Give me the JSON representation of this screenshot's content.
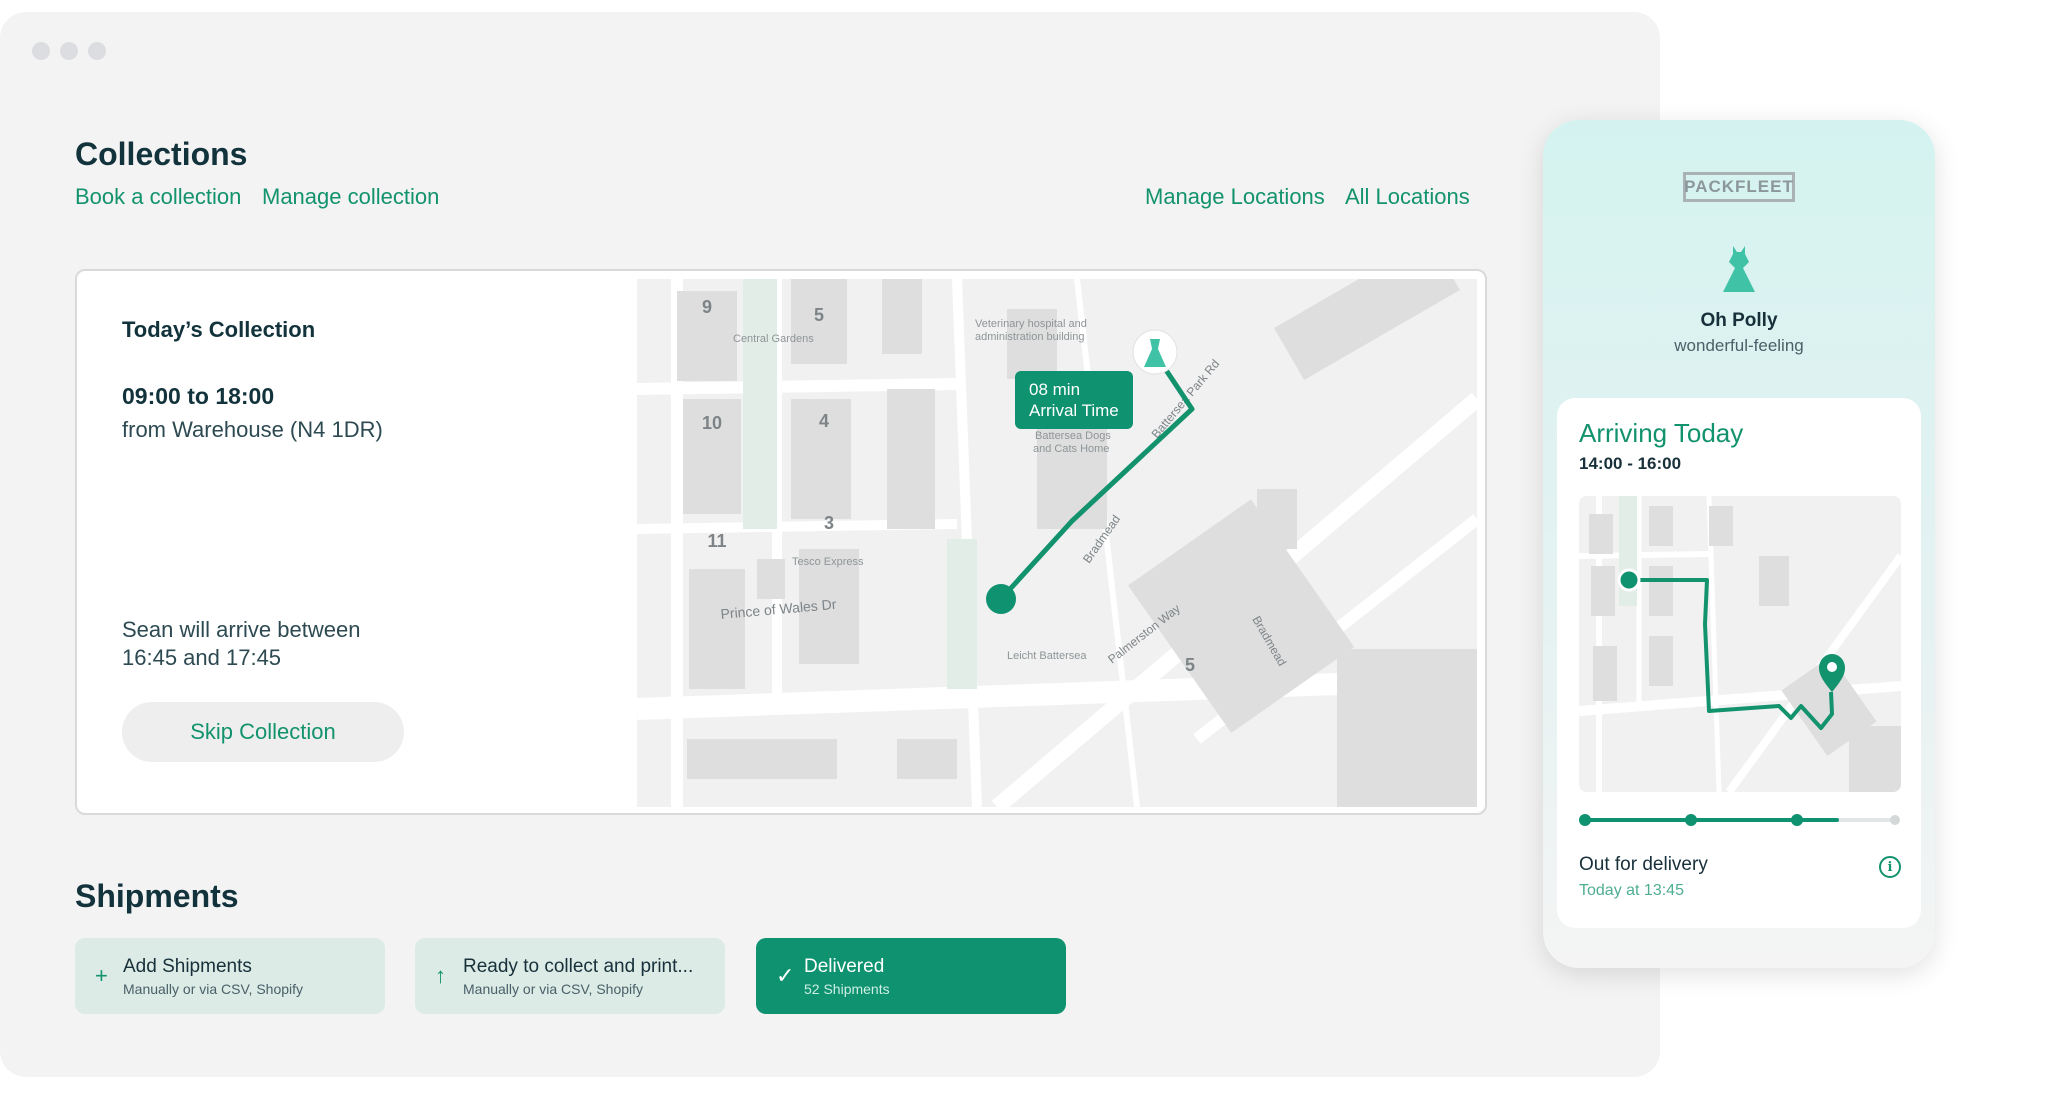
{
  "collections": {
    "title": "Collections",
    "links": {
      "book": "Book a collection",
      "manage": "Manage collection",
      "manage_locations": "Manage Locations",
      "all_locations": "All Locations"
    }
  },
  "todays_collection": {
    "title": "Today’s Collection",
    "time": "09:00 to 18:00",
    "from": "from Warehouse (N4 1DR)",
    "arrival_line1": "Sean will arrive between",
    "arrival_line2": "16:45 and 17:45",
    "skip_label": "Skip Collection"
  },
  "map": {
    "eta_value": "08 min",
    "eta_label": "Arrival Time",
    "labels": {
      "central_gardens": "Central Gardens",
      "vet_1": "Veterinary hospital and",
      "vet_2": "administration building",
      "dogs_1": "Battersea Dogs",
      "dogs_2": "and Cats Home",
      "tesco": "Tesco Express",
      "prince": "Prince of Wales Dr",
      "bradmead": "Bradmead",
      "battersea_park_rd": "Battersea Park Rd",
      "leicht": "Leicht Battersea",
      "palmerston": "Palmerston Way",
      "bradmead2": "Bradmead"
    },
    "block_numbers": {
      "b9": "9",
      "b5": "5",
      "b10": "10",
      "b4": "4",
      "b11": "11",
      "b3": "3",
      "b5b": "5"
    }
  },
  "shipments": {
    "title": "Shipments",
    "cards": [
      {
        "icon": "plus-icon",
        "title": "Add Shipments",
        "subtitle": "Manually or via CSV, Shopify"
      },
      {
        "icon": "arrow-up-icon",
        "title": "Ready to collect and print...",
        "subtitle": "Manually or via CSV, Shopify"
      },
      {
        "icon": "check-icon",
        "title": "Delivered",
        "subtitle": "52 Shipments"
      }
    ]
  },
  "phone": {
    "brand": "PACKFLEET",
    "merchant_name": "Oh Polly",
    "merchant_tagline": "wonderful-feeling",
    "arriving_title": "Arriving Today",
    "arriving_time": "14:00 - 16:00",
    "status": "Out for delivery",
    "status_time": "Today at 13:45",
    "progress": 0.82
  },
  "colors": {
    "accent": "#13936d",
    "accent_dark": "#0e9270",
    "dress": "#3fc2a6"
  }
}
